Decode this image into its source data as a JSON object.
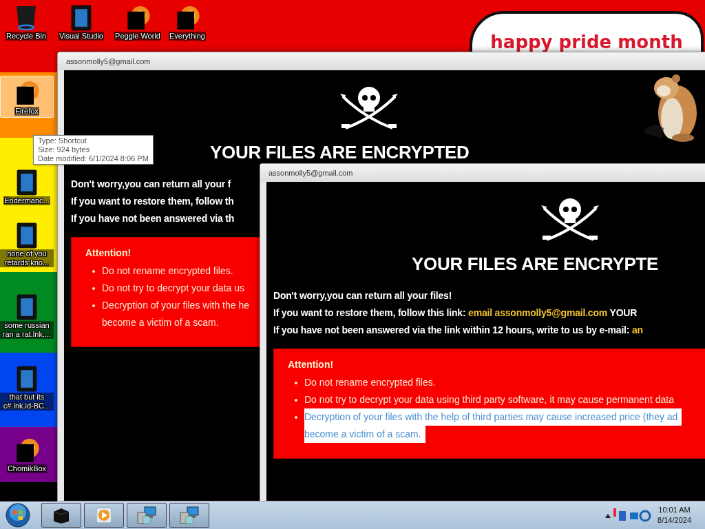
{
  "desktop_icons": [
    {
      "label": "Recycle Bin",
      "kind": "bin",
      "selected": false
    },
    {
      "label": "Visual Studio",
      "kind": "monitor",
      "selected": false
    },
    {
      "label": "Peggle World",
      "kind": "redacted",
      "selected": false
    },
    {
      "label": "Everything",
      "kind": "redacted",
      "selected": false
    },
    {
      "label": "Firefox",
      "kind": "redacted",
      "selected": true
    },
    {
      "label": "Endermanc...",
      "kind": "monitor",
      "selected": false
    },
    {
      "label": "none of you retards kno...",
      "kind": "monitor",
      "selected": false
    },
    {
      "label": "some russian ran a rat.lnk....",
      "kind": "monitor",
      "selected": false
    },
    {
      "label": "that but its c#.lnk.id-BC...",
      "kind": "monitor",
      "selected": false
    },
    {
      "label": "ChomikBox",
      "kind": "redacted",
      "selected": false
    }
  ],
  "sticker": {
    "text": "happy pride month"
  },
  "windows": [
    {
      "title": "assonmolly5@gmail.com",
      "heading": "YOUR FILES ARE ENCRYPTED",
      "lines": [
        [
          {
            "kind": "plain",
            "text": "Don't worry,you can return all your f"
          }
        ],
        [
          {
            "kind": "plain",
            "text": "If you want to restore them, follow th"
          }
        ],
        [
          {
            "kind": "plain",
            "text": "If you have not been answered via th"
          }
        ]
      ],
      "notice": {
        "title": "Attention!",
        "items": [
          {
            "lines": [
              "Do not rename encrypted files."
            ],
            "highlighted": false
          },
          {
            "lines": [
              "Do not try to decrypt your data us"
            ],
            "highlighted": false
          },
          {
            "lines": [
              "Decryption of your files with the he",
              "become a victim of a scam."
            ],
            "highlighted": false
          }
        ]
      }
    },
    {
      "title": "assonmolly5@gmail.com",
      "heading": "YOUR FILES ARE ENCRYPTE",
      "lines": [
        [
          {
            "kind": "plain",
            "text": "Don't worry,you can return all your files!"
          }
        ],
        [
          {
            "kind": "plain",
            "text": "If you want to restore them, follow this link: "
          },
          {
            "kind": "email",
            "text": "email assonmolly5@gmail.com"
          },
          {
            "kind": "plain",
            "text": "  YOUR"
          }
        ],
        [
          {
            "kind": "plain",
            "text": "If you have not been answered via the link within 12 hours, write to us by e-mail: "
          },
          {
            "kind": "email",
            "text": "an"
          }
        ]
      ],
      "notice": {
        "title": "Attention!",
        "items": [
          {
            "lines": [
              "Do not rename encrypted files."
            ],
            "highlighted": false
          },
          {
            "lines": [
              "Do not try to decrypt your data using third party software, it may cause permanent data"
            ],
            "highlighted": false
          },
          {
            "lines": [
              "Decryption of your files with the help of third parties may cause increased price (they ad",
              "become a victim of a scam."
            ],
            "highlighted": true
          }
        ]
      }
    }
  ],
  "tooltip": [
    "Type: Shortcut",
    "Size: 924 bytes",
    "Date modified: 6/1/2024 8:06 PM"
  ],
  "taskbar": {
    "buttons": [
      {
        "kind": "black-box"
      },
      {
        "kind": "media"
      },
      {
        "kind": "installer"
      },
      {
        "kind": "installer"
      }
    ],
    "clock": {
      "time": "10:01 AM",
      "date": "8/14/2024"
    }
  }
}
